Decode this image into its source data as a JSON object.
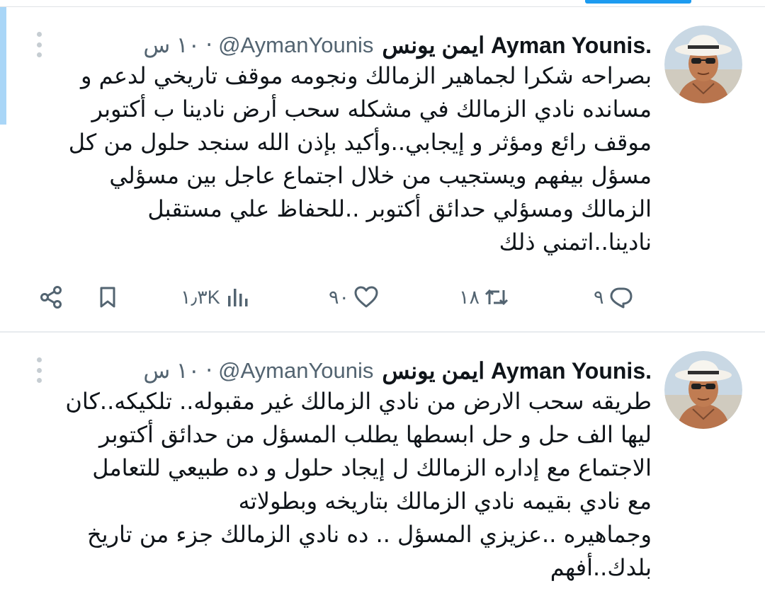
{
  "colors": {
    "text": "#0f1419",
    "secondary": "#536471",
    "accent": "#1d9bf0",
    "divider": "#e7ebee"
  },
  "tweets": [
    {
      "author_name": "ايمن يونس Ayman Younis.",
      "handle": "@AymanYounis",
      "separator": "·",
      "time": "١٠ س",
      "text": "بصراحه شكرا لجماهير الزمالك ونجومه موقف تاريخي لدعم و\nمسانده نادي الزمالك في مشكله سحب أرض نادينا ب أكتوبر\nموقف رائع ومؤثر و إيجابي..وأكيد بإذن الله سنجد حلول من كل\nمسؤل بيفهم ويستجيب من خلال اجتماع عاجل بين مسؤلي\nالزمالك ومسؤلي حدائق أكتوبر ..للحفاظ علي مستقبل\nنادينا..اتمني ذلك",
      "replies": "٩",
      "retweets": "١٨",
      "likes": "٩٠",
      "views": "١٫٣K",
      "icons": {
        "reply": "reply-icon",
        "retweet": "retweet-icon",
        "like": "heart-icon",
        "views": "views-chart-icon",
        "bookmark": "bookmark-icon",
        "share": "share-icon"
      }
    },
    {
      "author_name": "ايمن يونس Ayman Younis.",
      "handle": "@AymanYounis",
      "separator": "·",
      "time": "١٠ س",
      "text": "طريقه سحب الارض من نادي الزمالك  غير مقبوله.. تلكيكه..كان\nليها الف حل و حل ابسطها يطلب المسؤل من حدائق أكتوبر\nالاجتماع مع إداره الزمالك ل إيجاد حلول و ده طبيعي للتعامل\nمع نادي بقيمه نادي الزمالك بتاريخه وبطولاته\nوجماهيره ..عزيزي المسؤل .. ده نادي الزمالك جزء من تاريخ\nبلدك..أفهم"
    }
  ]
}
